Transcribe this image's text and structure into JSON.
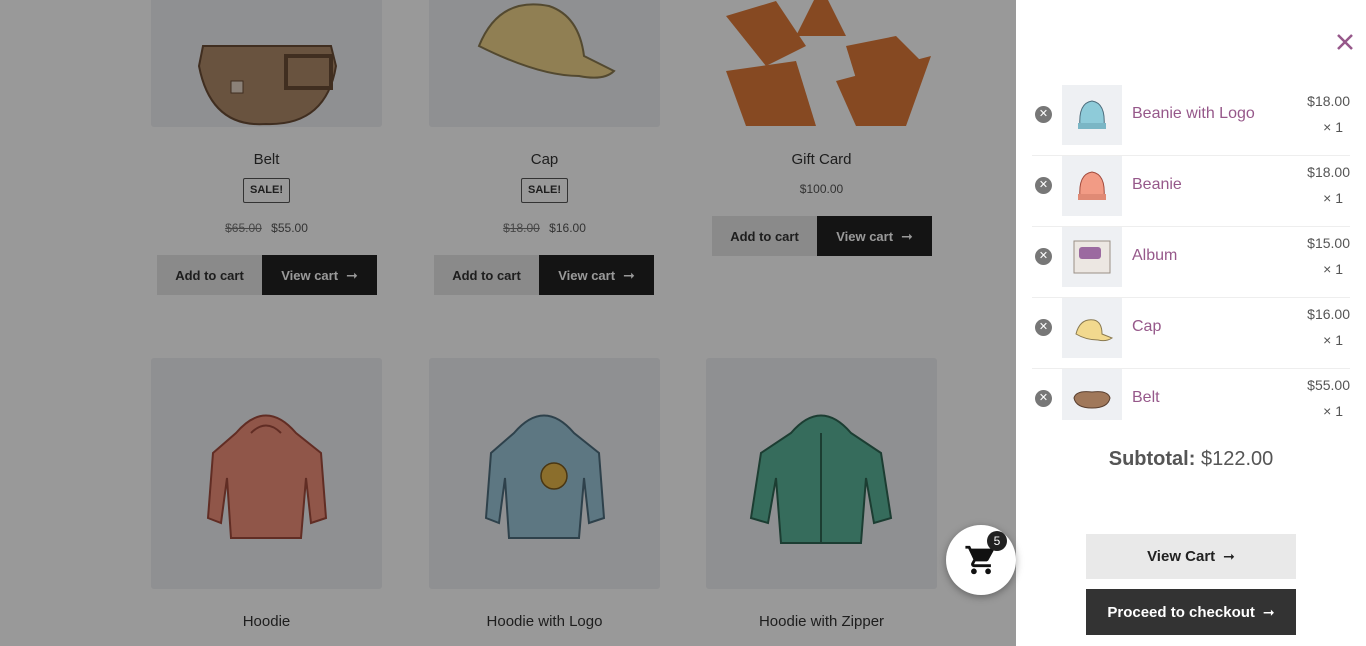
{
  "products": [
    {
      "name": "Belt",
      "sale_badge": "SALE!",
      "old_price": "$65.00",
      "price": "$55.00",
      "add_label": "Add to cart",
      "view_label": "View cart"
    },
    {
      "name": "Cap",
      "sale_badge": "SALE!",
      "old_price": "$18.00",
      "price": "$16.00",
      "add_label": "Add to cart",
      "view_label": "View cart"
    },
    {
      "name": "Gift Card",
      "price": "$100.00",
      "add_label": "Add to cart",
      "view_label": "View cart"
    },
    {
      "name": "Hoodie"
    },
    {
      "name": "Hoodie with Logo"
    },
    {
      "name": "Hoodie with Zipper"
    }
  ],
  "cart_fab": {
    "count": "5",
    "icon": "cart-icon"
  },
  "panel": {
    "close_icon": "close-icon",
    "items": [
      {
        "name": "Beanie with Logo",
        "price": "$18.00",
        "qty": "× 1",
        "color": "#8ecbd9"
      },
      {
        "name": "Beanie",
        "price": "$18.00",
        "qty": "× 1",
        "color": "#f29b85"
      },
      {
        "name": "Album",
        "price": "$15.00",
        "qty": "× 1",
        "color": "#cfc7c0"
      },
      {
        "name": "Cap",
        "price": "$16.00",
        "qty": "× 1",
        "color": "#f2d98e"
      },
      {
        "name": "Belt",
        "price": "$55.00",
        "qty": "× 1",
        "color": "#a0785a"
      }
    ],
    "subtotal_label": "Subtotal:",
    "subtotal_value": "$122.00",
    "view_cart_label": "View Cart",
    "checkout_label": "Proceed to checkout"
  },
  "colors": {
    "accent": "#96588a",
    "dark": "#222222",
    "overlay": "rgba(0,0,0,0.4)"
  }
}
